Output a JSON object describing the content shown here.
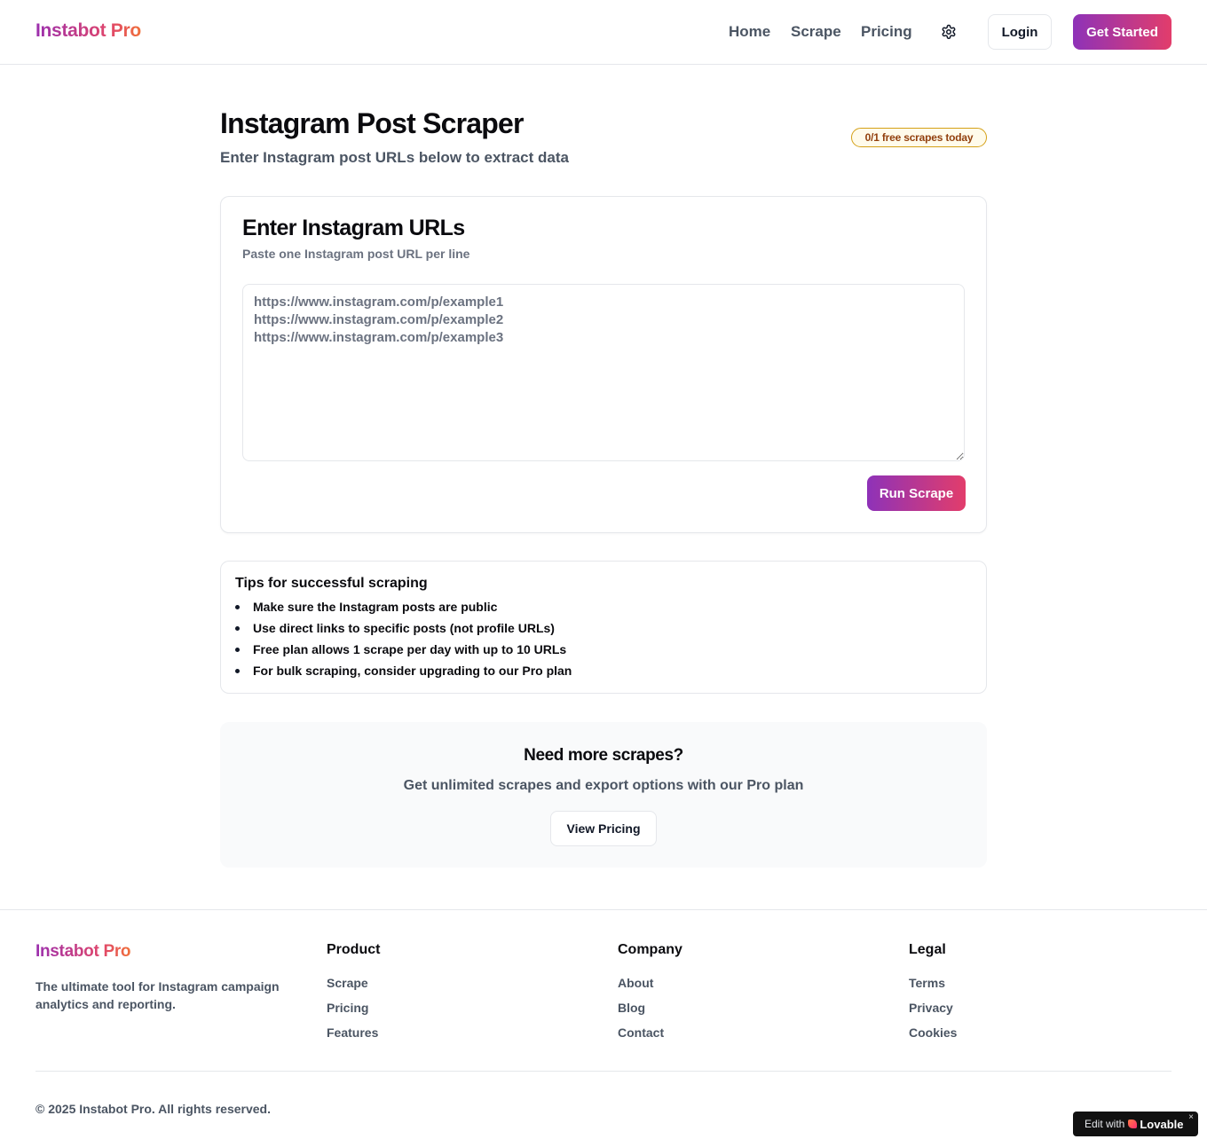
{
  "header": {
    "logo": "Instabot Pro",
    "nav": [
      {
        "label": "Home"
      },
      {
        "label": "Scrape"
      },
      {
        "label": "Pricing"
      }
    ],
    "settings_icon": "gear-icon",
    "login_label": "Login",
    "cta_label": "Get Started"
  },
  "main": {
    "title": "Instagram Post Scraper",
    "subtitle": "Enter Instagram post URLs below to extract data",
    "quota_badge": "0/1 free scrapes today",
    "input_card": {
      "title": "Enter Instagram URLs",
      "description": "Paste one Instagram post URL per line",
      "placeholder": "https://www.instagram.com/p/example1\nhttps://www.instagram.com/p/example2\nhttps://www.instagram.com/p/example3",
      "value": "",
      "run_label": "Run Scrape"
    },
    "tips": {
      "title": "Tips for successful scraping",
      "items": [
        "Make sure the Instagram posts are public",
        "Use direct links to specific posts (not profile URLs)",
        "Free plan allows 1 scrape per day with up to 10 URLs",
        "For bulk scraping, consider upgrading to our Pro plan"
      ]
    },
    "upsell": {
      "title": "Need more scrapes?",
      "description": "Get unlimited scrapes and export options with our Pro plan",
      "button_label": "View Pricing"
    }
  },
  "footer": {
    "logo": "Instabot Pro",
    "tagline": "The ultimate tool for Instagram campaign analytics and reporting.",
    "columns": [
      {
        "title": "Product",
        "links": [
          "Scrape",
          "Pricing",
          "Features"
        ]
      },
      {
        "title": "Company",
        "links": [
          "About",
          "Blog",
          "Contact"
        ]
      },
      {
        "title": "Legal",
        "links": [
          "Terms",
          "Privacy",
          "Cookies"
        ]
      }
    ],
    "copyright": "© 2025 Instabot Pro. All rights reserved."
  },
  "badge_widget": {
    "prefix": "Edit with",
    "brand": "Lovable",
    "close": "×"
  },
  "colors": {
    "brand_gradient_start": "#8e32b8",
    "brand_gradient_end": "#e23d6b",
    "badge_border": "#d4a017",
    "badge_text": "#92400e"
  }
}
